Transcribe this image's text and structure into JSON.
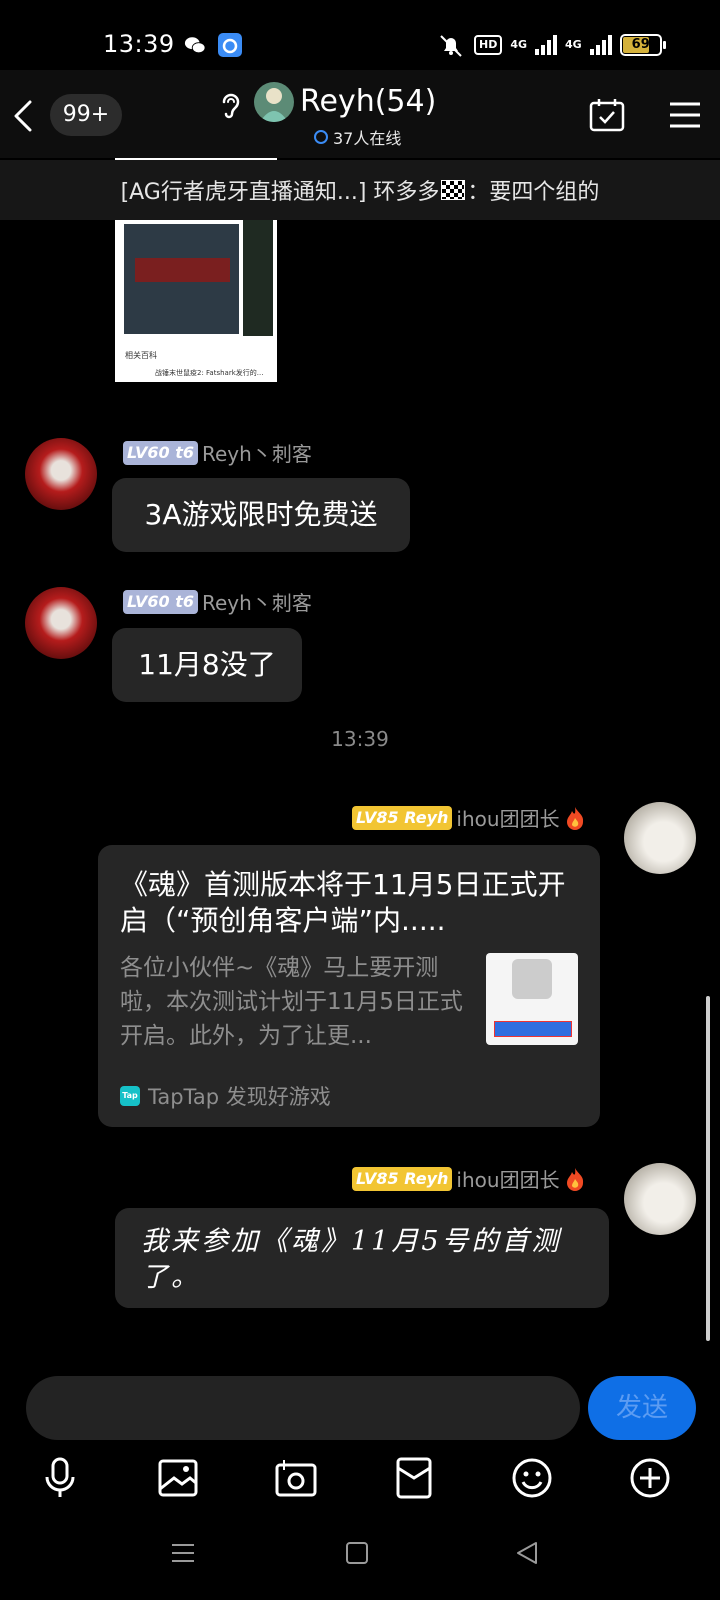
{
  "status_bar": {
    "time": "13:39",
    "hd_label": "HD",
    "network_1": "4G",
    "network_2": "4G",
    "battery_level": "69"
  },
  "header": {
    "unread_count": "99+",
    "group_name": "Reyh(54)",
    "online_count": "37人在线"
  },
  "notice": {
    "text_before": "[AG行者虎牙直播通知...] 环多多",
    "text_after": "：要四个组的"
  },
  "thumbnail": {
    "caption": "相关百科",
    "caption2": "战锤末世鼠疫2: Fatshark发行的..."
  },
  "messages": [
    {
      "level": "LV60",
      "rank": "t6",
      "sender": "Reyh丶刺客",
      "text": "3A游戏限时免费送"
    },
    {
      "level": "LV60",
      "rank": "t6",
      "sender": "Reyh丶刺客",
      "text": "11月8没了"
    }
  ],
  "timestamp": "13:39",
  "my_messages": [
    {
      "level": "LV85",
      "badge_name": "Reyh",
      "sender": "ihou团团长",
      "card": {
        "title": "《魂》首测版本将于11月5日正式开启（“预创角客户端”内.....",
        "description": "各位小伙伴~《魂》马上要开测啦，本次测试计划于11月5日正式开启。此外，为了让更...",
        "source": "TapTap 发现好游戏",
        "source_icon_text": "Tap"
      }
    },
    {
      "level": "LV85",
      "badge_name": "Reyh",
      "sender": "ihou团团长",
      "text": "我来参加《魂》11月5号的首测了。"
    }
  ],
  "composer": {
    "input_value": "",
    "send_label": "发送"
  },
  "colors": {
    "accent": "#0f6fe6",
    "bubble": "#262626",
    "lv_gold": "#f2c533",
    "lv_gray": "#aab4d8"
  }
}
